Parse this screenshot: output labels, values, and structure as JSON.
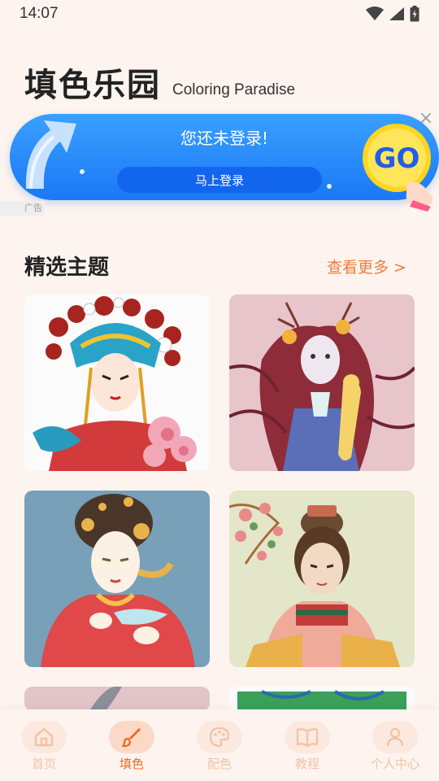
{
  "status_bar": {
    "time": "14:07"
  },
  "header": {
    "title": "填色乐园",
    "subtitle": "Coloring Paradise"
  },
  "banner": {
    "message": "您还未登录!",
    "login_button": "马上登录",
    "go_label": "GO",
    "close_symbol": "×",
    "ad_tag": "广告"
  },
  "featured": {
    "title": "精选主题",
    "see_more": "查看更多 >"
  },
  "nav": {
    "items": [
      {
        "label": "首页",
        "icon": "home-icon",
        "active": false
      },
      {
        "label": "填色",
        "icon": "brush-icon",
        "active": true
      },
      {
        "label": "配色",
        "icon": "palette-icon",
        "active": false
      },
      {
        "label": "教程",
        "icon": "book-icon",
        "active": false
      },
      {
        "label": "个人中心",
        "icon": "person-icon",
        "active": false
      }
    ]
  },
  "colors": {
    "accent": "#ef6a20",
    "banner_blue": "#1a78f5",
    "background": "#fdf4ef"
  }
}
